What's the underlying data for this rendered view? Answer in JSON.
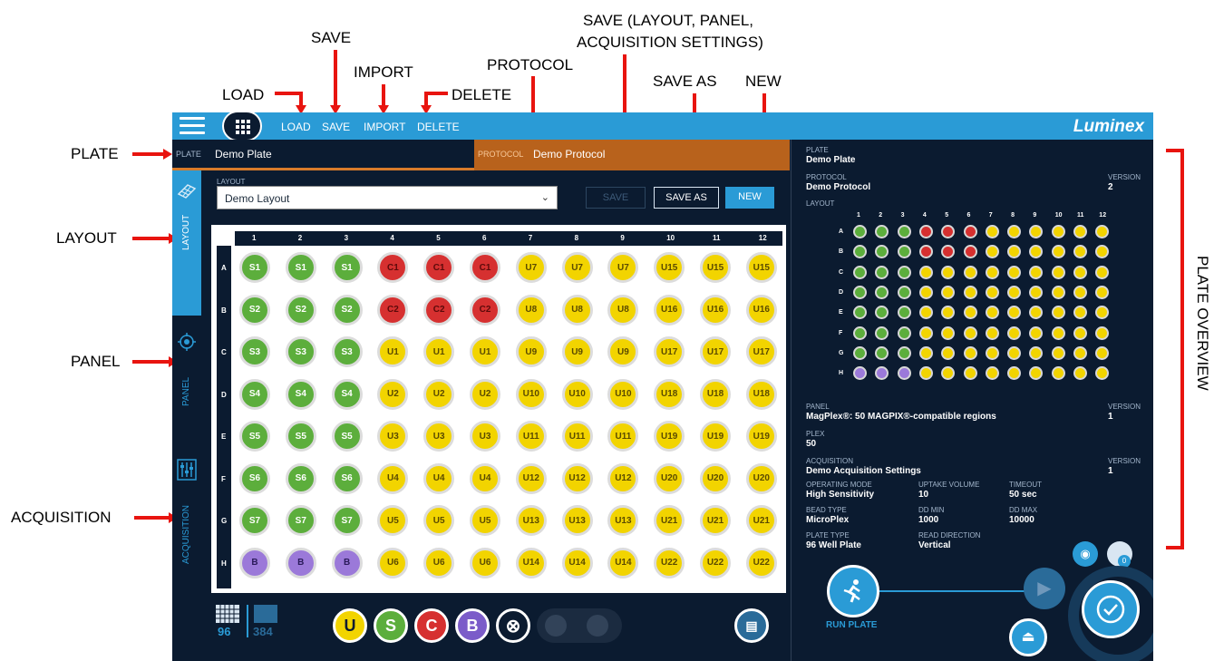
{
  "callouts": {
    "plate": "PLATE",
    "layout": "LAYOUT",
    "panel": "PANEL",
    "acquisition": "ACQUISITION",
    "load": "LOAD",
    "save": "SAVE",
    "import": "IMPORT",
    "delete": "DELETE",
    "protocol": "PROTOCOL",
    "save_settings_line1": "SAVE (LAYOUT, PANEL,",
    "save_settings_line2": "ACQUISITION SETTINGS)",
    "save_as": "SAVE AS",
    "new": "NEW",
    "plate_overview": "PLATE OVERVIEW"
  },
  "topbar": {
    "menu": [
      "LOAD",
      "SAVE",
      "IMPORT",
      "DELETE"
    ],
    "brand": "Luminex"
  },
  "plate_bar": {
    "label": "PLATE",
    "value": "Demo Plate"
  },
  "protocol_bar": {
    "label": "PROTOCOL",
    "value": "Demo Protocol"
  },
  "tabs": {
    "layout": "LAYOUT",
    "panel": "PANEL",
    "acquisition": "ACQUISITION"
  },
  "layout": {
    "label": "LAYOUT",
    "selected": "Demo Layout",
    "buttons": {
      "save": "SAVE",
      "save_as": "SAVE AS",
      "new": "NEW"
    }
  },
  "plate": {
    "columns": [
      "1",
      "2",
      "3",
      "4",
      "5",
      "6",
      "7",
      "8",
      "9",
      "10",
      "11",
      "12"
    ],
    "rows": [
      "A",
      "B",
      "C",
      "D",
      "E",
      "F",
      "G",
      "H"
    ],
    "wells": [
      [
        "S1",
        "S1",
        "S1",
        "C1",
        "C1",
        "C1",
        "U7",
        "U7",
        "U7",
        "U15",
        "U15",
        "U15"
      ],
      [
        "S2",
        "S2",
        "S2",
        "C2",
        "C2",
        "C2",
        "U8",
        "U8",
        "U8",
        "U16",
        "U16",
        "U16"
      ],
      [
        "S3",
        "S3",
        "S3",
        "U1",
        "U1",
        "U1",
        "U9",
        "U9",
        "U9",
        "U17",
        "U17",
        "U17"
      ],
      [
        "S4",
        "S4",
        "S4",
        "U2",
        "U2",
        "U2",
        "U10",
        "U10",
        "U10",
        "U18",
        "U18",
        "U18"
      ],
      [
        "S5",
        "S5",
        "S5",
        "U3",
        "U3",
        "U3",
        "U11",
        "U11",
        "U11",
        "U19",
        "U19",
        "U19"
      ],
      [
        "S6",
        "S6",
        "S6",
        "U4",
        "U4",
        "U4",
        "U12",
        "U12",
        "U12",
        "U20",
        "U20",
        "U20"
      ],
      [
        "S7",
        "S7",
        "S7",
        "U5",
        "U5",
        "U5",
        "U13",
        "U13",
        "U13",
        "U21",
        "U21",
        "U21"
      ],
      [
        "B",
        "B",
        "B",
        "U6",
        "U6",
        "U6",
        "U14",
        "U14",
        "U14",
        "U22",
        "U22",
        "U22"
      ]
    ]
  },
  "well_colors": {
    "S": "#5cae3c",
    "C": "#d63030",
    "U": "#f2d400",
    "B": "#9b79d9"
  },
  "bottom": {
    "plate_96": "96",
    "plate_384": "384",
    "type_buttons": [
      "U",
      "S",
      "C",
      "B"
    ]
  },
  "overview": {
    "plate_label": "PLATE",
    "plate_value": "Demo Plate",
    "protocol_label": "PROTOCOL",
    "protocol_value": "Demo Protocol",
    "protocol_version_label": "VERSION",
    "protocol_version": "2",
    "layout_label": "LAYOUT",
    "mini_columns": [
      "1",
      "2",
      "3",
      "4",
      "5",
      "6",
      "7",
      "8",
      "9",
      "10",
      "11",
      "12"
    ],
    "mini_rows": [
      "A",
      "B",
      "C",
      "D",
      "E",
      "F",
      "G",
      "H"
    ],
    "panel_label": "PANEL",
    "panel_value": "MagPlex®: 50 MAGPIX®-compatible regions",
    "panel_version_label": "VERSION",
    "panel_version": "1",
    "plex_label": "PLEX",
    "plex_value": "50",
    "acq_label": "ACQUISITION",
    "acq_value": "Demo Acquisition Settings",
    "acq_version_label": "VERSION",
    "acq_version": "1",
    "operating_mode_label": "OPERATING MODE",
    "operating_mode": "High Sensitivity",
    "uptake_label": "UPTAKE VOLUME",
    "uptake": "10",
    "timeout_label": "TIMEOUT",
    "timeout": "50 sec",
    "bead_type_label": "BEAD TYPE",
    "bead_type": "MicroPlex",
    "dd_min_label": "DD MIN",
    "dd_min": "1000",
    "dd_max_label": "DD MAX",
    "dd_max": "10000",
    "plate_type_label": "PLATE TYPE",
    "plate_type": "96 Well Plate",
    "read_dir_label": "READ DIRECTION",
    "read_dir": "Vertical",
    "run_plate": "RUN PLATE",
    "badge_count": "0"
  }
}
